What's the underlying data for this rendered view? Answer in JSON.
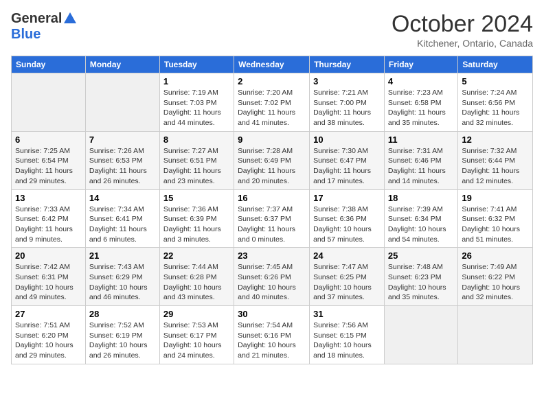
{
  "logo": {
    "general": "General",
    "blue": "Blue"
  },
  "title": "October 2024",
  "location": "Kitchener, Ontario, Canada",
  "headers": [
    "Sunday",
    "Monday",
    "Tuesday",
    "Wednesday",
    "Thursday",
    "Friday",
    "Saturday"
  ],
  "weeks": [
    [
      {
        "day": "",
        "sunrise": "",
        "sunset": "",
        "daylight": ""
      },
      {
        "day": "",
        "sunrise": "",
        "sunset": "",
        "daylight": ""
      },
      {
        "day": "1",
        "sunrise": "Sunrise: 7:19 AM",
        "sunset": "Sunset: 7:03 PM",
        "daylight": "Daylight: 11 hours and 44 minutes."
      },
      {
        "day": "2",
        "sunrise": "Sunrise: 7:20 AM",
        "sunset": "Sunset: 7:02 PM",
        "daylight": "Daylight: 11 hours and 41 minutes."
      },
      {
        "day": "3",
        "sunrise": "Sunrise: 7:21 AM",
        "sunset": "Sunset: 7:00 PM",
        "daylight": "Daylight: 11 hours and 38 minutes."
      },
      {
        "day": "4",
        "sunrise": "Sunrise: 7:23 AM",
        "sunset": "Sunset: 6:58 PM",
        "daylight": "Daylight: 11 hours and 35 minutes."
      },
      {
        "day": "5",
        "sunrise": "Sunrise: 7:24 AM",
        "sunset": "Sunset: 6:56 PM",
        "daylight": "Daylight: 11 hours and 32 minutes."
      }
    ],
    [
      {
        "day": "6",
        "sunrise": "Sunrise: 7:25 AM",
        "sunset": "Sunset: 6:54 PM",
        "daylight": "Daylight: 11 hours and 29 minutes."
      },
      {
        "day": "7",
        "sunrise": "Sunrise: 7:26 AM",
        "sunset": "Sunset: 6:53 PM",
        "daylight": "Daylight: 11 hours and 26 minutes."
      },
      {
        "day": "8",
        "sunrise": "Sunrise: 7:27 AM",
        "sunset": "Sunset: 6:51 PM",
        "daylight": "Daylight: 11 hours and 23 minutes."
      },
      {
        "day": "9",
        "sunrise": "Sunrise: 7:28 AM",
        "sunset": "Sunset: 6:49 PM",
        "daylight": "Daylight: 11 hours and 20 minutes."
      },
      {
        "day": "10",
        "sunrise": "Sunrise: 7:30 AM",
        "sunset": "Sunset: 6:47 PM",
        "daylight": "Daylight: 11 hours and 17 minutes."
      },
      {
        "day": "11",
        "sunrise": "Sunrise: 7:31 AM",
        "sunset": "Sunset: 6:46 PM",
        "daylight": "Daylight: 11 hours and 14 minutes."
      },
      {
        "day": "12",
        "sunrise": "Sunrise: 7:32 AM",
        "sunset": "Sunset: 6:44 PM",
        "daylight": "Daylight: 11 hours and 12 minutes."
      }
    ],
    [
      {
        "day": "13",
        "sunrise": "Sunrise: 7:33 AM",
        "sunset": "Sunset: 6:42 PM",
        "daylight": "Daylight: 11 hours and 9 minutes."
      },
      {
        "day": "14",
        "sunrise": "Sunrise: 7:34 AM",
        "sunset": "Sunset: 6:41 PM",
        "daylight": "Daylight: 11 hours and 6 minutes."
      },
      {
        "day": "15",
        "sunrise": "Sunrise: 7:36 AM",
        "sunset": "Sunset: 6:39 PM",
        "daylight": "Daylight: 11 hours and 3 minutes."
      },
      {
        "day": "16",
        "sunrise": "Sunrise: 7:37 AM",
        "sunset": "Sunset: 6:37 PM",
        "daylight": "Daylight: 11 hours and 0 minutes."
      },
      {
        "day": "17",
        "sunrise": "Sunrise: 7:38 AM",
        "sunset": "Sunset: 6:36 PM",
        "daylight": "Daylight: 10 hours and 57 minutes."
      },
      {
        "day": "18",
        "sunrise": "Sunrise: 7:39 AM",
        "sunset": "Sunset: 6:34 PM",
        "daylight": "Daylight: 10 hours and 54 minutes."
      },
      {
        "day": "19",
        "sunrise": "Sunrise: 7:41 AM",
        "sunset": "Sunset: 6:32 PM",
        "daylight": "Daylight: 10 hours and 51 minutes."
      }
    ],
    [
      {
        "day": "20",
        "sunrise": "Sunrise: 7:42 AM",
        "sunset": "Sunset: 6:31 PM",
        "daylight": "Daylight: 10 hours and 49 minutes."
      },
      {
        "day": "21",
        "sunrise": "Sunrise: 7:43 AM",
        "sunset": "Sunset: 6:29 PM",
        "daylight": "Daylight: 10 hours and 46 minutes."
      },
      {
        "day": "22",
        "sunrise": "Sunrise: 7:44 AM",
        "sunset": "Sunset: 6:28 PM",
        "daylight": "Daylight: 10 hours and 43 minutes."
      },
      {
        "day": "23",
        "sunrise": "Sunrise: 7:45 AM",
        "sunset": "Sunset: 6:26 PM",
        "daylight": "Daylight: 10 hours and 40 minutes."
      },
      {
        "day": "24",
        "sunrise": "Sunrise: 7:47 AM",
        "sunset": "Sunset: 6:25 PM",
        "daylight": "Daylight: 10 hours and 37 minutes."
      },
      {
        "day": "25",
        "sunrise": "Sunrise: 7:48 AM",
        "sunset": "Sunset: 6:23 PM",
        "daylight": "Daylight: 10 hours and 35 minutes."
      },
      {
        "day": "26",
        "sunrise": "Sunrise: 7:49 AM",
        "sunset": "Sunset: 6:22 PM",
        "daylight": "Daylight: 10 hours and 32 minutes."
      }
    ],
    [
      {
        "day": "27",
        "sunrise": "Sunrise: 7:51 AM",
        "sunset": "Sunset: 6:20 PM",
        "daylight": "Daylight: 10 hours and 29 minutes."
      },
      {
        "day": "28",
        "sunrise": "Sunrise: 7:52 AM",
        "sunset": "Sunset: 6:19 PM",
        "daylight": "Daylight: 10 hours and 26 minutes."
      },
      {
        "day": "29",
        "sunrise": "Sunrise: 7:53 AM",
        "sunset": "Sunset: 6:17 PM",
        "daylight": "Daylight: 10 hours and 24 minutes."
      },
      {
        "day": "30",
        "sunrise": "Sunrise: 7:54 AM",
        "sunset": "Sunset: 6:16 PM",
        "daylight": "Daylight: 10 hours and 21 minutes."
      },
      {
        "day": "31",
        "sunrise": "Sunrise: 7:56 AM",
        "sunset": "Sunset: 6:15 PM",
        "daylight": "Daylight: 10 hours and 18 minutes."
      },
      {
        "day": "",
        "sunrise": "",
        "sunset": "",
        "daylight": ""
      },
      {
        "day": "",
        "sunrise": "",
        "sunset": "",
        "daylight": ""
      }
    ]
  ]
}
